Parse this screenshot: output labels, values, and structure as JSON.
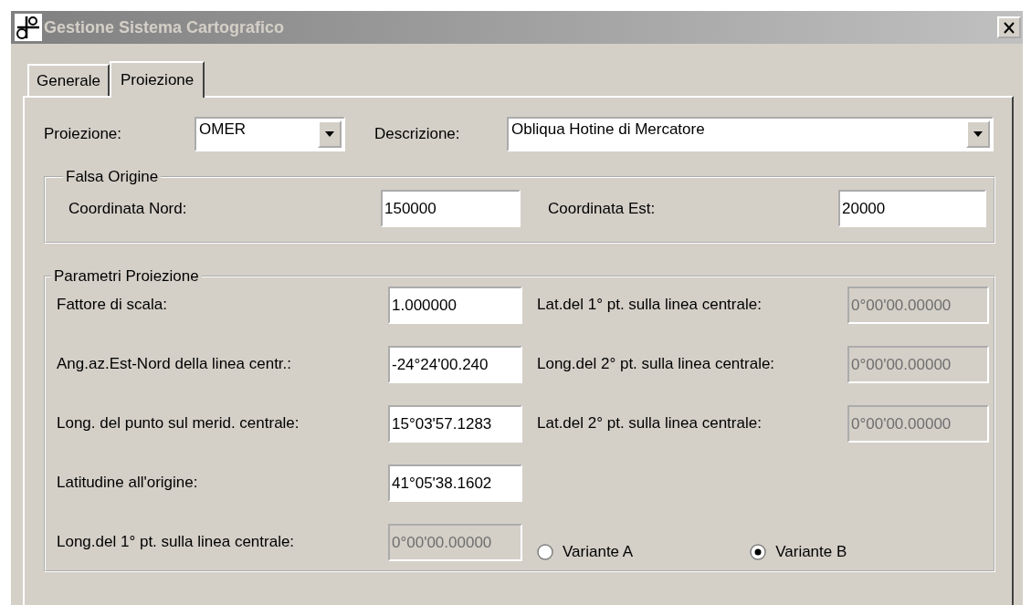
{
  "window": {
    "title": "Gestione Sistema Cartografico"
  },
  "tabs": [
    {
      "label": "Generale",
      "selected": false
    },
    {
      "label": "Proiezione",
      "selected": true
    }
  ],
  "projection": {
    "label": "Proiezione:",
    "value": "OMER"
  },
  "description": {
    "label": "Descrizione:",
    "value": "Obliqua Hotine di Mercatore"
  },
  "false_origin": {
    "title": "Falsa Origine",
    "fields": [
      {
        "label": "Coordinata Nord:",
        "value": "150000"
      },
      {
        "label": "Coordinata Est:",
        "value": "20000"
      }
    ]
  },
  "parameters": {
    "title": "Parametri Proiezione",
    "left": [
      {
        "label": "Fattore di scala:",
        "value": "1.000000",
        "disabled": false
      },
      {
        "label": "Ang.az.Est-Nord della linea centr.:",
        "value": "-24°24'00.240",
        "disabled": false
      },
      {
        "label": "Long. del punto sul merid. centrale:",
        "value": "15°03'57.1283",
        "disabled": false
      },
      {
        "label": "Latitudine all'origine:",
        "value": "41°05'38.1602",
        "disabled": false
      },
      {
        "label": "Long.del 1° pt. sulla linea centrale:",
        "value": "0°00'00.00000",
        "disabled": true
      }
    ],
    "right": [
      {
        "label": "Lat.del 1° pt. sulla linea centrale:",
        "value": "0°00'00.00000",
        "disabled": true
      },
      {
        "label": "Long.del 2° pt. sulla linea centrale:",
        "value": "0°00'00.00000",
        "disabled": true
      },
      {
        "label": "Lat.del 2° pt. sulla linea centrale:",
        "value": "0°00'00.00000",
        "disabled": true
      }
    ],
    "variants": [
      {
        "label": "Variante A",
        "selected": false
      },
      {
        "label": "Variante B",
        "selected": true
      }
    ]
  }
}
